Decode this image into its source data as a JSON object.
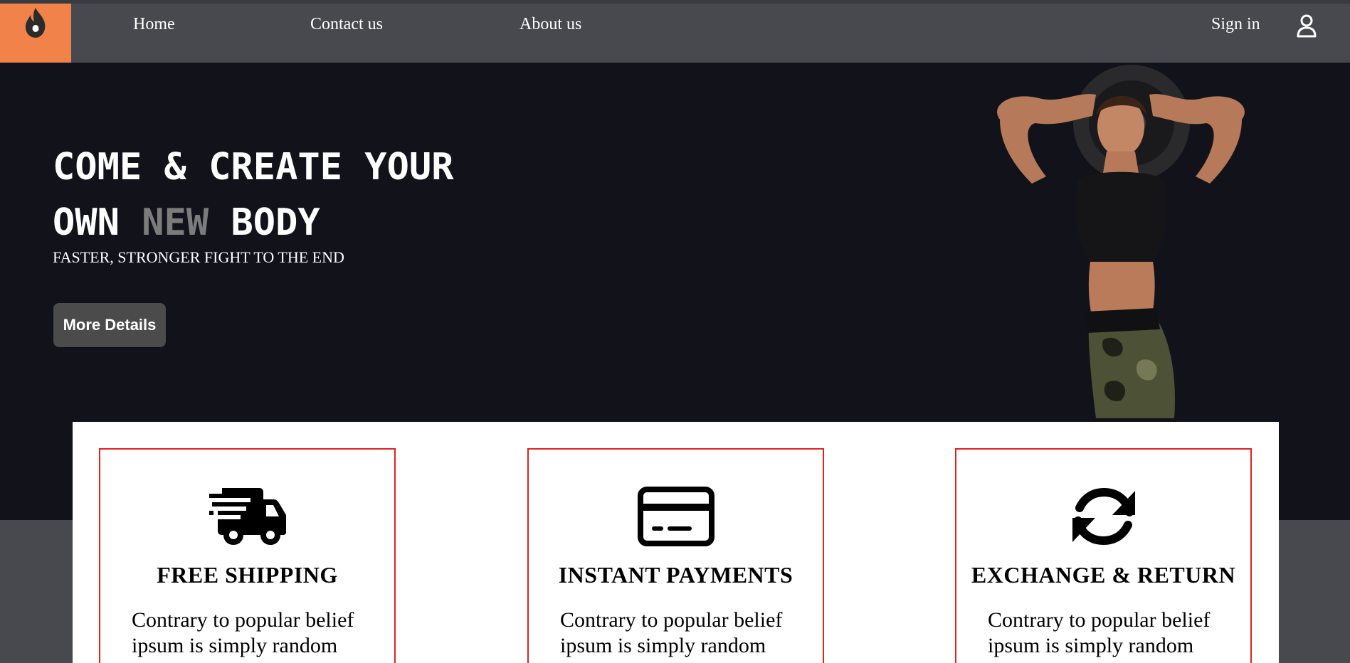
{
  "nav": {
    "logo_icon": "flame-logo-icon",
    "links": [
      {
        "label": "Home"
      },
      {
        "label": "Contact us"
      },
      {
        "label": "About us"
      }
    ],
    "signin_label": "Sign in",
    "user_icon": "user-icon"
  },
  "hero": {
    "title_line1": "COME & CREATE YOUR",
    "title_line2_before": "OWN ",
    "title_line2_accent": "NEW",
    "title_line2_after": " BODY",
    "subtitle": "FASTER, STRONGER FIGHT TO THE END",
    "button_label": "More Details"
  },
  "features": [
    {
      "icon": "truck-icon",
      "title": "FREE SHIPPING",
      "text": "Contrary to popular belief ipsum is simply random"
    },
    {
      "icon": "credit-card-icon",
      "title": "INSTANT PAYMENTS",
      "text": "Contrary to popular belief ipsum is simply random"
    },
    {
      "icon": "refresh-icon",
      "title": "EXCHANGE & RETURN",
      "text": "Contrary to popular belief ipsum is simply random"
    }
  ],
  "colors": {
    "logo_bg": "#f0824a",
    "nav_bg": "#47494e",
    "hero_bg": "#12131a",
    "accent_text": "#7c7c7c",
    "card_border": "#e32222",
    "button_bg": "#4b4b4b"
  }
}
